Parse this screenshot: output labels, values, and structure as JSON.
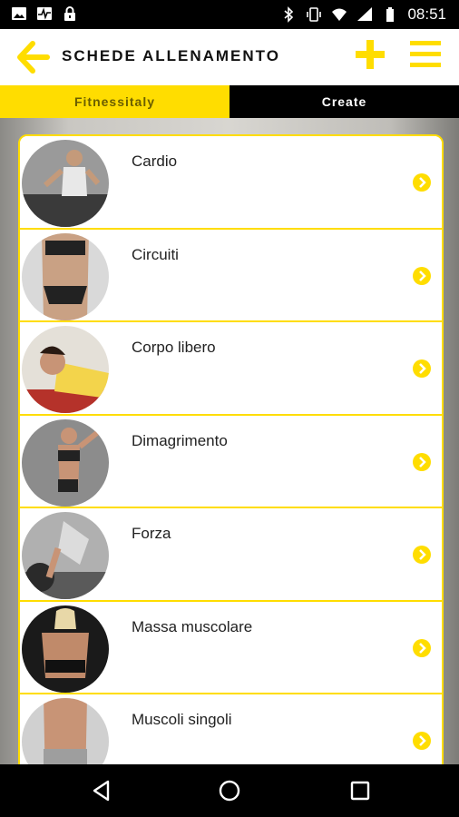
{
  "status_bar": {
    "time": "08:51",
    "left_icons": [
      "image-icon",
      "activity-icon",
      "lock-icon"
    ],
    "right_icons": [
      "bluetooth-icon",
      "vibrate-icon",
      "wifi-icon",
      "signal-icon",
      "battery-icon"
    ]
  },
  "app_bar": {
    "title": "SCHEDE ALLENAMENTO",
    "accent": "#ffdd00"
  },
  "tabs": [
    {
      "label": "Fitnessitaly",
      "active": true
    },
    {
      "label": "Create",
      "active": false
    }
  ],
  "workout_list": {
    "items": [
      {
        "label": "Cardio"
      },
      {
        "label": "Circuiti"
      },
      {
        "label": "Corpo libero"
      },
      {
        "label": "Dimagrimento"
      },
      {
        "label": "Forza"
      },
      {
        "label": "Massa muscolare"
      },
      {
        "label": "Muscoli singoli"
      }
    ]
  },
  "nav_bar": {
    "buttons": [
      "back-triangle-icon",
      "home-circle-icon",
      "recents-square-icon"
    ]
  }
}
